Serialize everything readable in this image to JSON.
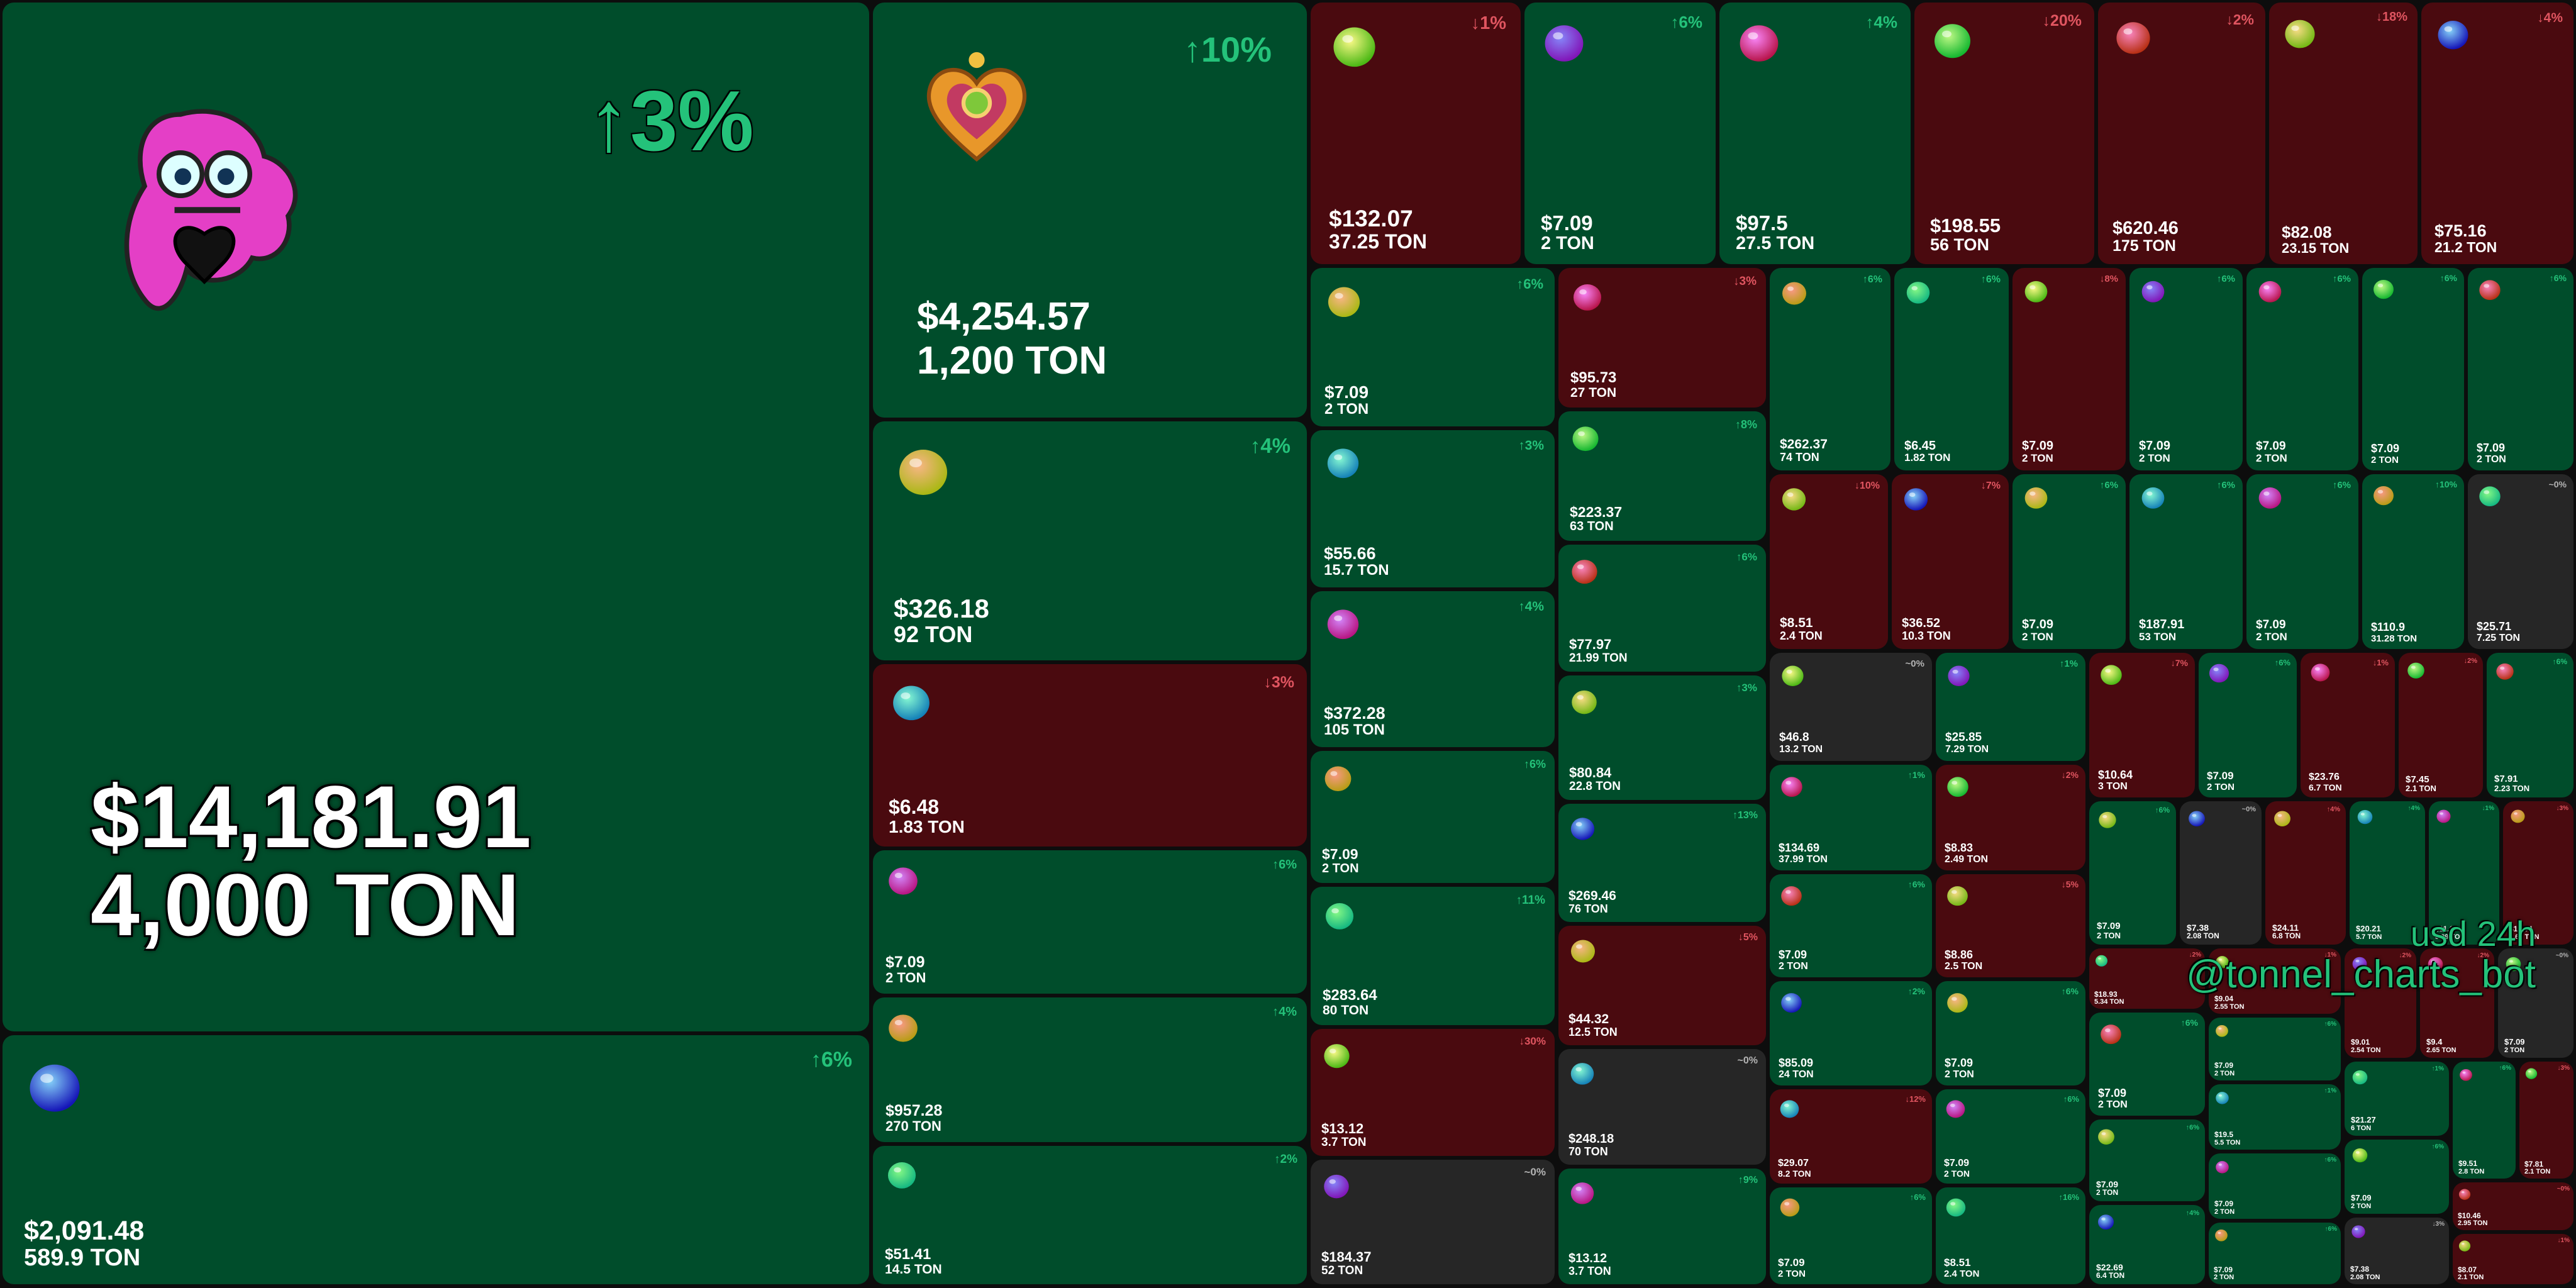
{
  "chart_data": {
    "type": "treemap",
    "colors": {
      "up": "#004d2b",
      "down": "#4a0a0f",
      "flat": "#262626",
      "up_text": "#24c27a",
      "down_text": "#e05560",
      "flat_text": "#b3b3b3"
    },
    "caption": {
      "period": "usd 24h",
      "bot": "@tonnel_charts_bot"
    },
    "items": [
      {
        "icon": "pink-creature-heart-icon",
        "change": "↑3%",
        "usd": "$14,181.91",
        "ton": "4,000 TON",
        "trend": "up"
      },
      {
        "icon": "golden-heart-locket-icon",
        "change": "↑10%",
        "usd": "$4,254.57",
        "ton": "1,200 TON",
        "trend": "up"
      },
      {
        "icon": "baseball-cap-icon",
        "change": "↑6%",
        "usd": "$2,091.48",
        "ton": "589.9 TON",
        "trend": "up"
      },
      {
        "icon": "leather-bag-icon",
        "change": "↑4%",
        "usd": "$326.18",
        "ton": "92 TON",
        "trend": "up"
      },
      {
        "icon": "dog-figure-icon",
        "change": "↓3%",
        "usd": "$6.48",
        "ton": "1.83 TON",
        "trend": "down"
      },
      {
        "icon": "magic-wand-icon",
        "change": "↑6%",
        "usd": "$7.09",
        "ton": "2 TON",
        "trend": "up"
      },
      {
        "icon": "potion-flask-icon",
        "change": "↑4%",
        "usd": "$957.28",
        "ton": "270 TON",
        "trend": "up"
      },
      {
        "icon": "teddy-bear-icon",
        "change": "↑2%",
        "usd": "$51.41",
        "ton": "14.5 TON",
        "trend": "up"
      },
      {
        "icon": "cat-icon",
        "change": "↓1%",
        "usd": "$132.07",
        "ton": "37.25 TON",
        "trend": "down"
      },
      {
        "icon": "calendar-icon",
        "change": "↑6%",
        "usd": "$7.09",
        "ton": "2 TON",
        "trend": "up"
      },
      {
        "icon": "game-console-icon",
        "change": "↑4%",
        "usd": "$97.5",
        "ton": "27.5 TON",
        "trend": "up"
      },
      {
        "icon": "cactus-icon",
        "change": "↓20%",
        "usd": "$198.55",
        "ton": "56 TON",
        "trend": "down"
      },
      {
        "icon": "spartan-helmet-icon",
        "change": "↓2%",
        "usd": "$620.46",
        "ton": "175 TON",
        "trend": "down"
      },
      {
        "icon": "car-icon",
        "change": "↓18%",
        "usd": "$82.08",
        "ton": "23.15 TON",
        "trend": "down"
      },
      {
        "icon": "cigar-icon",
        "change": "↓4%",
        "usd": "$75.16",
        "ton": "21.2 TON",
        "trend": "down"
      },
      {
        "icon": "birthday-cake-icon",
        "change": "↑6%",
        "usd": "$7.09",
        "ton": "2 TON",
        "trend": "up"
      },
      {
        "icon": "ring-box-icon",
        "change": "↑3%",
        "usd": "$55.66",
        "ton": "15.7 TON",
        "trend": "up"
      },
      {
        "icon": "bracelet-icon",
        "change": "↑4%",
        "usd": "$372.28",
        "ton": "105 TON",
        "trend": "up"
      },
      {
        "icon": "snack-pack-icon",
        "change": "↑6%",
        "usd": "$7.09",
        "ton": "2 TON",
        "trend": "up"
      },
      {
        "icon": "crystal-icon",
        "change": "↑11%",
        "usd": "$283.64",
        "ton": "80 TON",
        "trend": "up"
      },
      {
        "icon": "dragon-icon",
        "change": "↓30%",
        "usd": "$13.12",
        "ton": "3.7 TON",
        "trend": "down"
      },
      {
        "icon": "ring-icon",
        "change": "~0%",
        "usd": "$184.37",
        "ton": "52 TON",
        "trend": "flat"
      },
      {
        "icon": "frog-icon",
        "change": "↓3%",
        "usd": "$95.73",
        "ton": "27 TON",
        "trend": "down"
      },
      {
        "icon": "signet-ring-icon",
        "change": "↑8%",
        "usd": "$223.37",
        "ton": "63 TON",
        "trend": "up"
      },
      {
        "icon": "bracelet-icon",
        "change": "↑6%",
        "usd": "$77.97",
        "ton": "21.99 TON",
        "trend": "up"
      },
      {
        "icon": "bag-icon",
        "change": "↑3%",
        "usd": "$80.84",
        "ton": "22.8 TON",
        "trend": "up"
      },
      {
        "icon": "trophy-icon",
        "change": "↑13%",
        "usd": "$269.46",
        "ton": "76 TON",
        "trend": "up"
      },
      {
        "icon": "gingerbread-icon",
        "change": "↓5%",
        "usd": "$44.32",
        "ton": "12.5 TON",
        "trend": "down"
      },
      {
        "icon": "chocolate-icon",
        "change": "~0%",
        "usd": "$248.18",
        "ton": "70 TON",
        "trend": "flat"
      },
      {
        "icon": "flower-icon",
        "change": "↑9%",
        "usd": "$13.12",
        "ton": "3.7 TON",
        "trend": "up"
      },
      {
        "icon": "perfume-icon",
        "change": "↑6%",
        "usd": "$262.37",
        "ton": "74 TON",
        "trend": "up"
      },
      {
        "icon": "cake-icon",
        "change": "↑6%",
        "usd": "$6.45",
        "ton": "1.82 TON",
        "trend": "up"
      },
      {
        "icon": "orb-icon",
        "change": "↓8%",
        "usd": "$7.09",
        "ton": "2 TON",
        "trend": "down"
      },
      {
        "icon": "bouquet-icon",
        "change": "↑6%",
        "usd": "$7.09",
        "ton": "2 TON",
        "trend": "up"
      },
      {
        "icon": "snow-globe-icon",
        "change": "↑6%",
        "usd": "$7.09",
        "ton": "2 TON",
        "trend": "up"
      },
      {
        "icon": "sparkler-icon",
        "change": "↑6%",
        "usd": "$7.09",
        "ton": "2 TON",
        "trend": "up"
      },
      {
        "icon": "heart-cookie-icon",
        "change": "↑6%",
        "usd": "$7.09",
        "ton": "2 TON",
        "trend": "up"
      },
      {
        "icon": "feather-icon",
        "change": "↓10%",
        "usd": "$8.51",
        "ton": "2.4 TON",
        "trend": "down"
      },
      {
        "icon": "lantern-icon",
        "change": "↓7%",
        "usd": "$36.52",
        "ton": "10.3 TON",
        "trend": "down"
      },
      {
        "icon": "wand-icon",
        "change": "↑6%",
        "usd": "$7.09",
        "ton": "2 TON",
        "trend": "up"
      },
      {
        "icon": "potion-icon",
        "change": "↑6%",
        "usd": "$187.91",
        "ton": "53 TON",
        "trend": "up"
      },
      {
        "icon": "candy-icon",
        "change": "↑6%",
        "usd": "$7.09",
        "ton": "2 TON",
        "trend": "up"
      },
      {
        "icon": "lips-icon",
        "change": "↑10%",
        "usd": "$110.9",
        "ton": "31.28 TON",
        "trend": "up"
      },
      {
        "icon": "top-hat-icon",
        "change": "~0%",
        "usd": "$25.71",
        "ton": "7.25 TON",
        "trend": "flat"
      },
      {
        "icon": "pumpkin-icon",
        "change": "~0%",
        "usd": "$46.8",
        "ton": "13.2 TON",
        "trend": "flat"
      },
      {
        "icon": "apple-icon",
        "change": "↑1%",
        "usd": "$25.85",
        "ton": "7.29 TON",
        "trend": "up"
      },
      {
        "icon": "genie-lamp-icon",
        "change": "↑1%",
        "usd": "$134.69",
        "ton": "37.99 TON",
        "trend": "up"
      },
      {
        "icon": "mushroom-icon",
        "change": "↓2%",
        "usd": "$8.83",
        "ton": "2.49 TON",
        "trend": "down"
      },
      {
        "icon": "cookie-man-icon",
        "change": "↑6%",
        "usd": "$7.09",
        "ton": "2 TON",
        "trend": "up"
      },
      {
        "icon": "pie-icon",
        "change": "↓5%",
        "usd": "$8.86",
        "ton": "2.5 TON",
        "trend": "down"
      },
      {
        "icon": "jack-o-lantern-icon",
        "change": "↑2%",
        "usd": "$85.09",
        "ton": "24 TON",
        "trend": "up"
      },
      {
        "icon": "popcorn-icon",
        "change": "↑6%",
        "usd": "$7.09",
        "ton": "2 TON",
        "trend": "up"
      },
      {
        "icon": "heart-charm-icon",
        "change": "↓12%",
        "usd": "$29.07",
        "ton": "8.2 TON",
        "trend": "down"
      },
      {
        "icon": "jester-hat-icon",
        "change": "↑6%",
        "usd": "$7.09",
        "ton": "2 TON",
        "trend": "up"
      },
      {
        "icon": "shoe-icon",
        "change": "↑6%",
        "usd": "$7.09",
        "ton": "2 TON",
        "trend": "up"
      },
      {
        "icon": "witch-hat-icon",
        "change": "↑16%",
        "usd": "$8.51",
        "ton": "2.4 TON",
        "trend": "up"
      },
      {
        "icon": "eyeball-icon",
        "change": "↓7%",
        "usd": "$10.64",
        "ton": "3 TON",
        "trend": "down"
      },
      {
        "icon": "gift-box-icon",
        "change": "↑6%",
        "usd": "$7.09",
        "ton": "2 TON",
        "trend": "up"
      },
      {
        "icon": "notebook-icon",
        "change": "↓1%",
        "usd": "$23.76",
        "ton": "6.7 TON",
        "trend": "down"
      },
      {
        "icon": "jar-icon",
        "change": "↓2%",
        "usd": "$7.45",
        "ton": "2.1 TON",
        "trend": "down"
      },
      {
        "icon": "flame-icon",
        "change": "↑6%",
        "usd": "$7.91",
        "ton": "2.23 TON",
        "trend": "up"
      },
      {
        "icon": "wreath-icon",
        "change": "↑6%",
        "usd": "$7.09",
        "ton": "2 TON",
        "trend": "up"
      },
      {
        "icon": "skull-icon",
        "change": "~0%",
        "usd": "$7.38",
        "ton": "2.08 TON",
        "trend": "flat"
      },
      {
        "icon": "broom-icon",
        "change": "↑4%",
        "usd": "$24.11",
        "ton": "6.8 TON",
        "trend": "down"
      },
      {
        "icon": "globe-icon",
        "change": "↑4%",
        "usd": "$20.21",
        "ton": "5.7 TON",
        "trend": "up"
      },
      {
        "icon": "candy-cane-icon",
        "change": "↓1%",
        "usd": "$11.67",
        "ton": "3.29 TON",
        "trend": "up"
      },
      {
        "icon": "star-icon",
        "change": "↓3%",
        "usd": "$12.94",
        "ton": "3.65 TON",
        "trend": "down"
      },
      {
        "icon": "crown-icon",
        "change": "↓2%",
        "usd": "$18.93",
        "ton": "5.34 TON",
        "trend": "down"
      },
      {
        "icon": "bow-icon",
        "change": "↓1%",
        "usd": "$9.04",
        "ton": "2.55 TON",
        "trend": "down"
      },
      {
        "icon": "candle-icon",
        "change": "↓2%",
        "usd": "$9.01",
        "ton": "2.54 TON",
        "trend": "down"
      },
      {
        "icon": "bell-icon",
        "change": "↓2%",
        "usd": "$9.4",
        "ton": "2.65 TON",
        "trend": "down"
      },
      {
        "icon": "book-icon",
        "change": "~0%",
        "usd": "$7.09",
        "ton": "2 TON",
        "trend": "flat"
      },
      {
        "icon": "snowflake-icon",
        "change": "↑6%",
        "usd": "$7.09",
        "ton": "2 TON",
        "trend": "up"
      },
      {
        "icon": "lollipop-icon",
        "change": "↑6%",
        "usd": "$7.09",
        "ton": "2 TON",
        "trend": "up"
      },
      {
        "icon": "cupcake-icon",
        "change": "↑4%",
        "usd": "$22.69",
        "ton": "6.4 TON",
        "trend": "up"
      },
      {
        "icon": "key-icon",
        "change": "↑6%",
        "usd": "$7.09",
        "ton": "2 TON",
        "trend": "up"
      },
      {
        "icon": "clover-icon",
        "change": "↑1%",
        "usd": "$19.5",
        "ton": "5.5 TON",
        "trend": "up"
      },
      {
        "icon": "sock-icon",
        "change": "↑6%",
        "usd": "$7.09",
        "ton": "2 TON",
        "trend": "up"
      },
      {
        "icon": "bunny-icon",
        "change": "↑6%",
        "usd": "$7.09",
        "ton": "2 TON",
        "trend": "up"
      },
      {
        "icon": "spider-icon",
        "change": "↑1%",
        "usd": "$21.27",
        "ton": "6 TON",
        "trend": "up"
      },
      {
        "icon": "donut-icon",
        "change": "↑6%",
        "usd": "$7.09",
        "ton": "2 TON",
        "trend": "up"
      },
      {
        "icon": "music-box-icon",
        "change": "↓3%",
        "usd": "$7.38",
        "ton": "2.08 TON",
        "trend": "flat"
      },
      {
        "icon": "mitten-icon",
        "change": "↑6%",
        "usd": "$9.51",
        "ton": "2.8 TON",
        "trend": "up"
      },
      {
        "icon": "bowtie-icon",
        "change": "↓3%",
        "usd": "$7.81",
        "ton": "2.1 TON",
        "trend": "down"
      },
      {
        "icon": "cherry-icon",
        "change": "~0%",
        "usd": "$10.46",
        "ton": "2.95 TON",
        "trend": "down"
      },
      {
        "icon": "bat-icon",
        "change": "↓1%",
        "usd": "$8.07",
        "ton": "2.1 TON",
        "trend": "down"
      }
    ]
  }
}
